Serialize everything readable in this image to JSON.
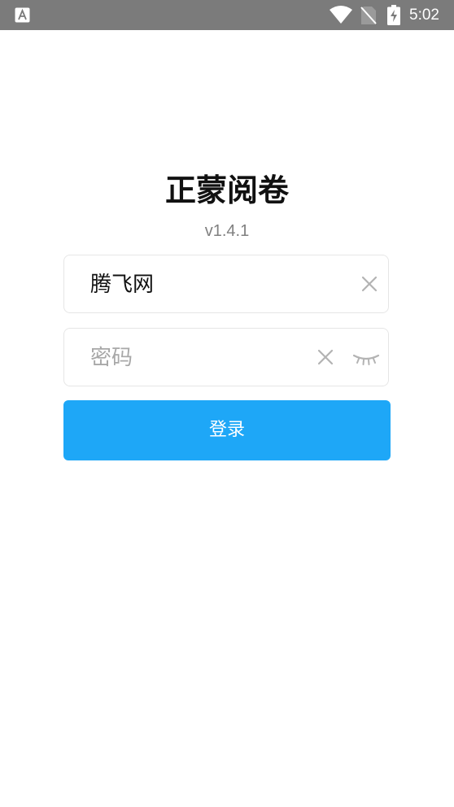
{
  "status_bar": {
    "time": "5:02",
    "icons": [
      "app-notification-icon",
      "wifi-icon",
      "no-sim-icon",
      "battery-charging-icon"
    ]
  },
  "app": {
    "title": "正蒙阅卷",
    "version": "v1.4.1"
  },
  "form": {
    "username": {
      "value": "腾飞网",
      "placeholder": ""
    },
    "password": {
      "value": "",
      "placeholder": "密码"
    },
    "login_label": "登录"
  },
  "colors": {
    "status_bar": "#7b7b7b",
    "primary": "#1ea7f7",
    "field_border": "#e6e6e6",
    "icon_gray": "#b3b3b3"
  }
}
